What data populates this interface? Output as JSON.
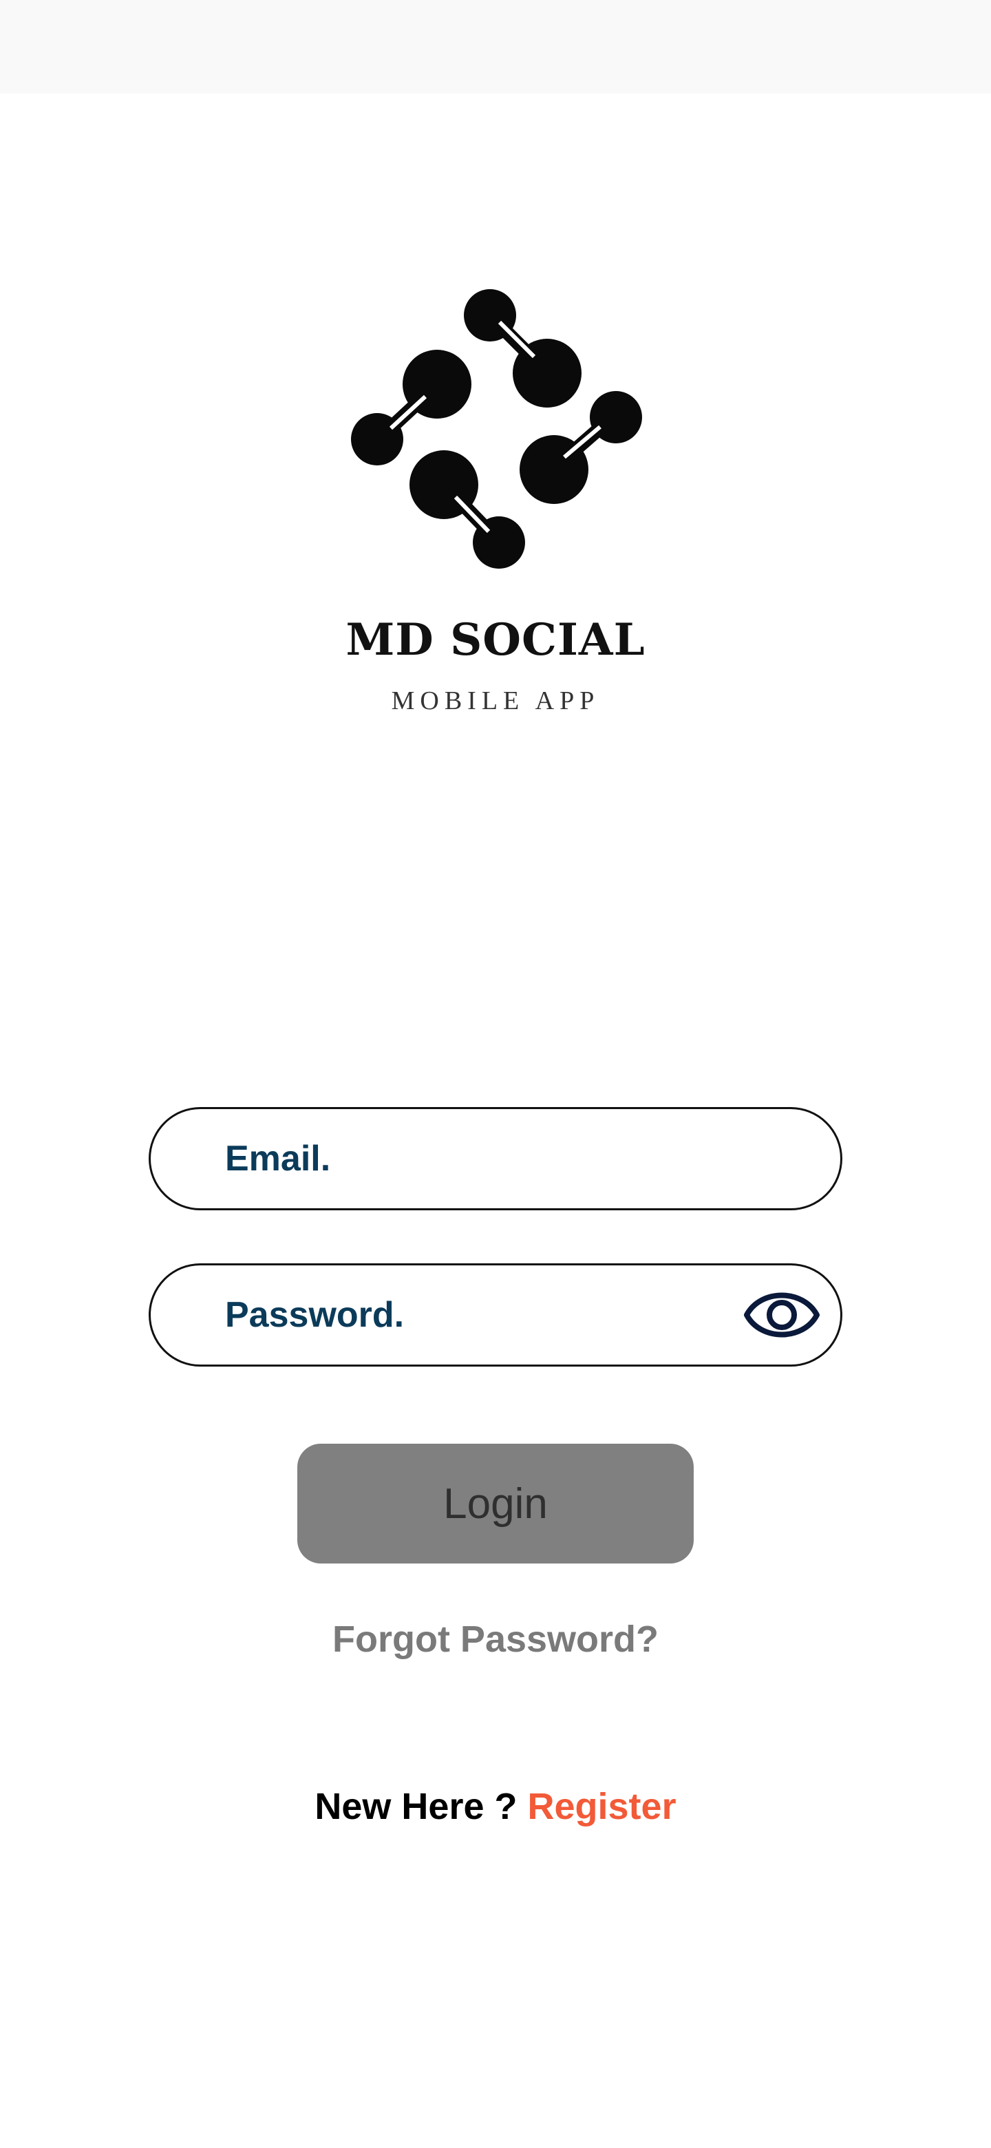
{
  "brand": {
    "name": "MD SOCIAL",
    "subtitle": "MOBILE APP"
  },
  "form": {
    "email_placeholder": "Email.",
    "password_placeholder": "Password.",
    "login_label": "Login",
    "forgot_label": "Forgot Password?",
    "register_prompt": "New Here ? ",
    "register_label": "Register"
  },
  "icons": {
    "logo": "dumbbells-logo",
    "password_toggle": "eye-icon"
  },
  "colors": {
    "field_text": "#0c3b5a",
    "login_bg": "#808080",
    "register_accent": "#f25a38",
    "forgot_text": "#7a7a7a"
  }
}
